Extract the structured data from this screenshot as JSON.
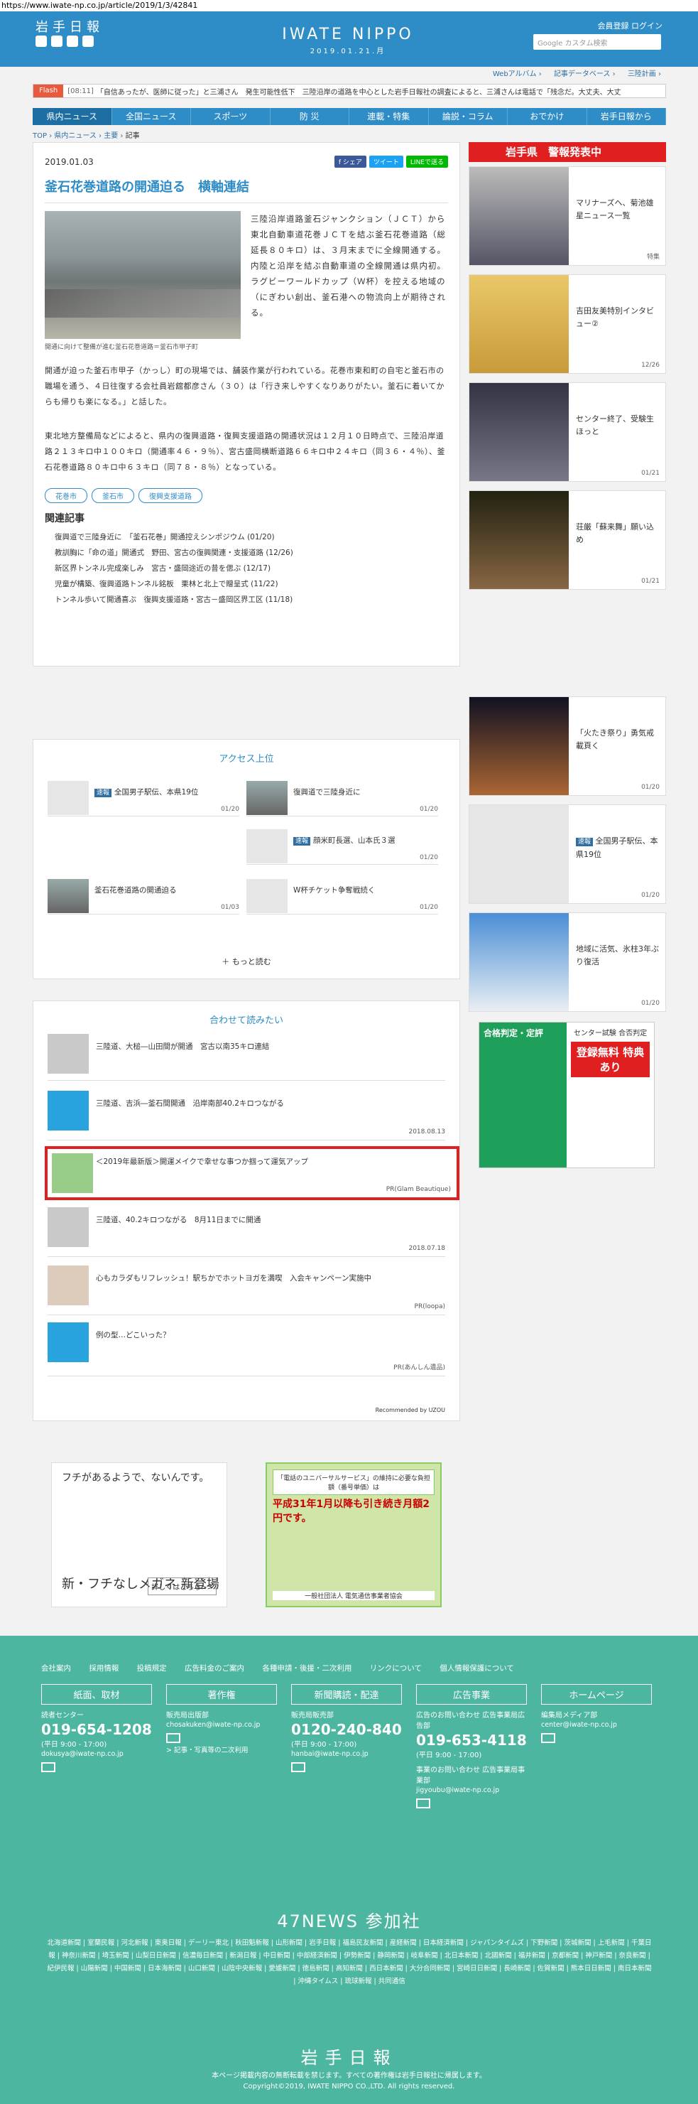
{
  "url": "https://www.iwate-np.co.jp/article/2019/1/3/42841",
  "header": {
    "logo_ja": "岩手日報",
    "logo_en": "IWATE NIPPO",
    "date_line": "2019.01.21.月",
    "links": "会員登録  ログイン",
    "search_placeholder": "Google カスタム検索",
    "subnav": [
      "Webアルバム ›",
      "記事データベース ›",
      "三陸計画 ›"
    ]
  },
  "flash": {
    "tag": "Flash",
    "time": "[08:11]",
    "text": "「自信あったが、医師に従った」と三浦さん　発生可能性低下　三陸沿岸の道路を中心とした岩手日報社の調査によると、三浦さんは電話で「残念だ。大丈夫、大丈"
  },
  "nav": [
    "県内ニュース",
    "全国ニュース",
    "スポーツ",
    "防 災",
    "連載・特集",
    "論説・コラム",
    "おでかけ",
    "岩手日報から"
  ],
  "breadcrumb": [
    "TOP",
    "県内ニュース",
    "主要",
    "記事"
  ],
  "article": {
    "date": "2019.01.03",
    "share": [
      "f シェア",
      "ツイート",
      "LINEで送る"
    ],
    "title": "釜石花巻道路の開通迫る　横軸連結",
    "caption": "開通に向けて整備が進む釜石花巻道路＝釜石市甲子町",
    "lead": "三陸沿岸道路釜石ジャンクション（ＪＣＴ）から東北自動車道花巻ＪＣＴを結ぶ釜石花巻道路（総延長８０キロ）は、３月末までに全線開通する。内陸と沿岸を結ぶ自動車道の全線開通は県内初。ラグビーワールドカップ（Ｗ杯）を控える地域の（にぎわい創出、釜石港への物流向上が期待される。",
    "body1": "開通が迫った釜石市甲子（かっし）町の現場では、舗装作業が行われている。花巻市東和町の自宅と釜石市の職場を通う、４日往復する会社員岩舘都彦さん（３０）は「行き来しやすくなりありがたい。釜石に着いてからも帰りも楽になる。」と話した。",
    "body2": "東北地方整備局などによると、県内の復興道路・復興支援道路の開通状況は１２月１０日時点で、三陸沿岸道路２１３キロ中１００キロ（開通率４６・９％）、宮古盛岡横断道路６６キロ中２４キロ（同３６・４％）、釜石花巻道路８０キロ中６３キロ（同７８・８％）となっている。",
    "tags": [
      "花巻市",
      "釜石市",
      "復興支援道路"
    ],
    "related_heading": "関連記事",
    "related": [
      "復興道で三陸身近に　「釜石花巻」開通控えシンポジウム (01/20)",
      "教訓胸に「命の道」開通式　野田、宮古の復興関連・支援道路 (12/26)",
      "新区界トンネル完成楽しみ　宮古・盛岡途近の昔を偲ぶ (12/17)",
      "児童が構築、復興道路トンネル銘板　栗林と北上で贈呈式 (11/22)",
      "トンネル歩いて開通喜ぶ　復興支援道路・宮古－盛岡区界工区 (11/18)"
    ]
  },
  "ranking": {
    "title": "アクセス上位",
    "items": [
      {
        "badge": "速報",
        "text": "全国男子駅伝、本県19位",
        "date": "01/20"
      },
      {
        "badge": "",
        "text": "復興道で三陸身近に",
        "date": "01/20"
      },
      {
        "badge": "速報",
        "text": "顔米町長選、山本氏３選",
        "date": "01/20"
      },
      {
        "badge": "",
        "text": "釜石花巻道路の開通迫る",
        "date": "01/03"
      },
      {
        "badge": "",
        "text": "W杯チケット争奪戦続く",
        "date": "01/20"
      }
    ],
    "more": "もっと読む"
  },
  "recommend": {
    "title": "合わせて読みたい",
    "items": [
      {
        "text": "三陸道、大槌―山田間が開通　宮古以南35キロ連結",
        "meta": ""
      },
      {
        "text": "三陸道、吉浜―釜石間開通　沿岸南部40.2キロつながる",
        "meta": "2018.08.13"
      },
      {
        "text": "＜2019年最新版＞開運メイクで幸せな事つか掴って運気アップ",
        "meta": "PR(Glam Beautique)"
      },
      {
        "text": "三陸道、40.2キロつながる　8月11日までに開通",
        "meta": "2018.07.18"
      },
      {
        "text": "心もカラダもリフレッシュ！駅ちかでホットヨガを満喫　入会キャンペーン実施中",
        "meta": "PR(loopa)"
      },
      {
        "text": "例の型…どこいった？",
        "meta": "PR(あんしん遺品)"
      }
    ],
    "footer": "Recommended by UZOU"
  },
  "ads": {
    "glasses_top": "フチがあるようで、ないんです。",
    "glasses_main": "新・フチなしメガネ 新登場",
    "glasses_more": "詳しくはこちら>>",
    "phone_top": "「電話のユニバーサルサービス」の維持に必要な負担額（番号単価）は",
    "phone_big": "平成31年1月以降も引き続き月額2円です。",
    "phone_foot": "一般社団法人 電気通信事業者協会",
    "side_top": "合格判定・定評",
    "side_title": "センター試験 合否判定",
    "side_cta": "登録無料 特典あり"
  },
  "side": {
    "warn": "岩手県　警報発表中",
    "items": [
      {
        "text": "マリナーズへ、菊池雄星ニュース一覧",
        "meta": "特集",
        "badge": ""
      },
      {
        "text": "吉田友美特別インタビュー②",
        "meta": "12/26",
        "badge": ""
      },
      {
        "text": "センター終了、受験生ほっと",
        "meta": "01/21",
        "badge": ""
      },
      {
        "text": "荘厳「蘇来舞」願い込め",
        "meta": "01/21",
        "badge": ""
      },
      {
        "text": "「火たき祭り」勇気戒載頁く",
        "meta": "01/20",
        "badge": ""
      },
      {
        "text": "全国男子駅伝、本県19位",
        "meta": "01/20",
        "badge": "速報"
      },
      {
        "text": "地域に活気、氷柱3年ぶり復活",
        "meta": "01/20",
        "badge": ""
      }
    ]
  },
  "footer": {
    "links": [
      "会社案内",
      "採用情報",
      "投稿規定",
      "広告料金のご案内",
      "各種申請・後援・二次利用",
      "リンクについて",
      "個人情報保護について"
    ],
    "cols": [
      {
        "h": "紙面、取材",
        "l1": "読者センター",
        "ph": "019-654-1208",
        "hr": "(平日 9:00 - 17:00)",
        "ml": "dokusya@iwate-np.co.jp",
        "extra": ""
      },
      {
        "h": "著作権",
        "l1": "販売局出版部",
        "ph": "",
        "hr": "",
        "ml": "chosakuken@iwate-np.co.jp",
        "extra": "> 記事・写真等の二次利用"
      },
      {
        "h": "新聞購読・配達",
        "l1": "販売局販売部",
        "ph": "0120-240-840",
        "hr": "(平日 9:00 - 17:00)",
        "ml": "hanbai@iwate-np.co.jp",
        "extra": ""
      },
      {
        "h": "広告事業",
        "l1": "広告のお問い合わせ 広告事業局広告部",
        "ph": "019-653-4118",
        "hr": "(平日 9:00 - 17:00)",
        "ml": "jigyoubu@iwate-np.co.jp",
        "extra": "事業のお問い合わせ 広告事業局事業部"
      },
      {
        "h": "ホームページ",
        "l1": "編集局メディア部",
        "ph": "",
        "hr": "",
        "ml": "center@iwate-np.co.jp",
        "extra": ""
      }
    ],
    "news47": "47NEWS 参加社",
    "papers": "北海道新聞 | 室蘭民報 | 河北新報 | 東奥日報 | デーリー東北 | 秋田魁新報 | 山形新聞 | 岩手日報 | 福島民友新聞 | 産経新聞 | 日本経済新聞 | ジャパンタイムズ | 下野新聞 | 茨城新聞 | 上毛新聞 | 千葉日報 | 神奈川新聞 | 埼玉新聞 | 山梨日日新聞 | 信濃毎日新聞 | 新潟日報 | 中日新聞 | 中部経済新聞 | 伊勢新聞 | 静岡新聞 | 岐阜新聞 | 北日本新聞 | 北國新聞 | 福井新聞 | 京都新聞 | 神戸新聞 | 奈良新聞 | 紀伊民報 | 山陽新聞 | 中国新聞 | 日本海新聞 | 山口新聞 | 山陰中央新報 | 愛媛新聞 | 徳島新聞 | 高知新聞 | 西日本新聞 | 大分合同新聞 | 宮崎日日新聞 | 長崎新聞 | 佐賀新聞 | 熊本日日新聞 | 南日本新聞 | 沖縄タイムス | 琉球新報 | 共同通信",
    "logo": "岩手日報",
    "copy1": "本ページ掲載内容の無断転載を禁じます。すべての著作権は岩手日報社に帰属します。",
    "copy2": "Copyright©2019, IWATE NIPPO CO.,LTD. All rights reserved."
  }
}
